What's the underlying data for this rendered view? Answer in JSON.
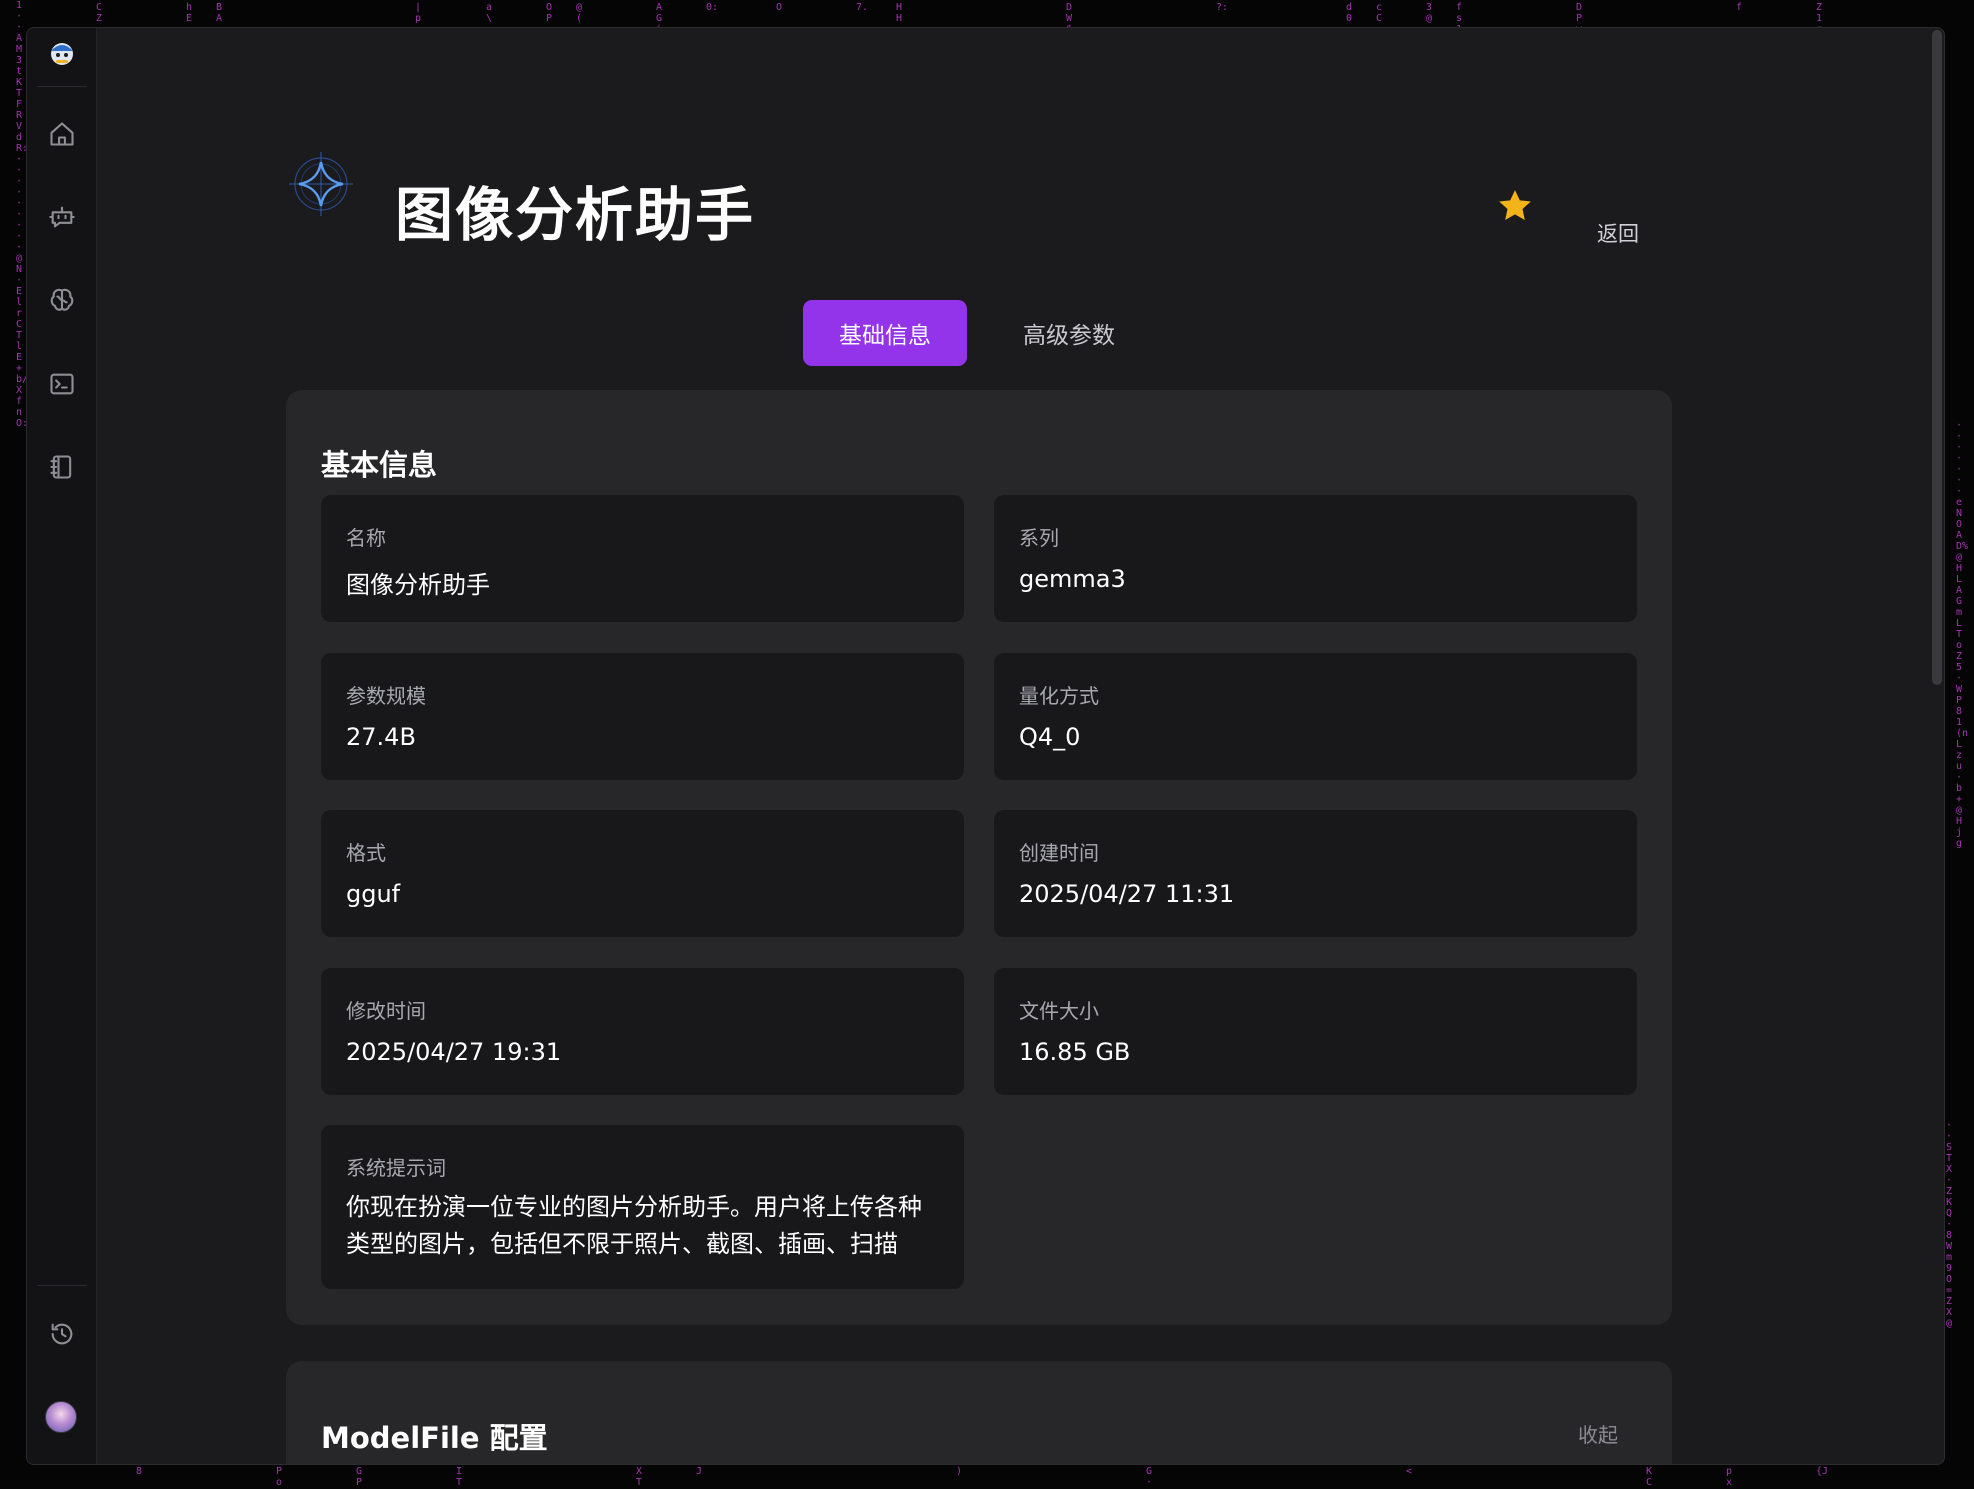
{
  "header": {
    "title": "图像分析助手",
    "back_label": "返回"
  },
  "tabs": [
    {
      "label": "基础信息",
      "active": true
    },
    {
      "label": "高级参数",
      "active": false
    }
  ],
  "basic_info": {
    "section_title": "基本信息",
    "fields": [
      {
        "label": "名称",
        "value": "图像分析助手"
      },
      {
        "label": "系列",
        "value": "gemma3"
      },
      {
        "label": "参数规模",
        "value": "27.4B"
      },
      {
        "label": "量化方式",
        "value": "Q4_0"
      },
      {
        "label": "格式",
        "value": "gguf"
      },
      {
        "label": "创建时间",
        "value": "2025/04/27 11:31"
      },
      {
        "label": "修改时间",
        "value": "2025/04/27 19:31"
      },
      {
        "label": "文件大小",
        "value": "16.85 GB"
      },
      {
        "label": "系统提示词",
        "value": "你现在扮演一位专业的图片分析助手。用户将上传各种类型的图片，包括但不限于照片、截图、插画、扫描"
      }
    ]
  },
  "modelfile": {
    "section_title": "ModelFile 配置",
    "collapse_label": "收起"
  },
  "sidebar": {
    "items": [
      {
        "icon": "home-icon"
      },
      {
        "icon": "robot-chat-icon"
      },
      {
        "icon": "brain-icon"
      },
      {
        "icon": "terminal-icon"
      },
      {
        "icon": "notebook-icon"
      },
      {
        "icon": "history-icon"
      }
    ]
  },
  "colors": {
    "accent": "#9333ea",
    "star": "#f5b31a",
    "background": "#1b1b1e",
    "panel": "#27272a",
    "field": "#18181b"
  }
}
